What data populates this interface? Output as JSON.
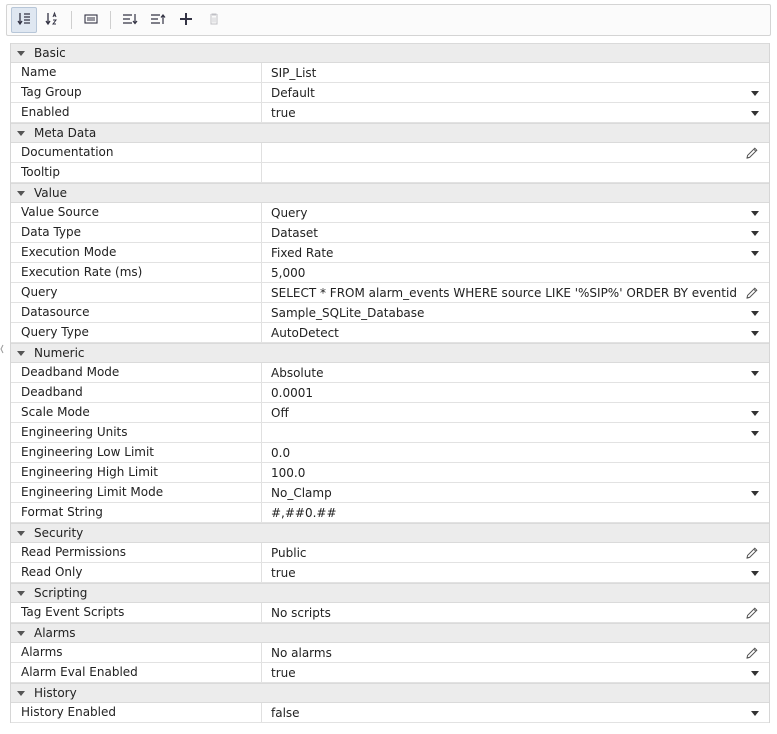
{
  "toolbar": {
    "buttons": [
      {
        "name": "sort-category-button",
        "icon": "sort-category-icon",
        "active": true
      },
      {
        "name": "sort-alpha-button",
        "icon": "sort-alpha-icon",
        "active": false
      },
      {
        "name": "toggle-description-button",
        "icon": "description-icon",
        "active": false
      },
      {
        "name": "expand-all-button",
        "icon": "expand-all-icon",
        "active": false
      },
      {
        "name": "collapse-all-button",
        "icon": "collapse-all-icon",
        "active": false
      },
      {
        "name": "add-property-button",
        "icon": "plus-icon",
        "active": false
      },
      {
        "name": "delete-property-button",
        "icon": "trash-icon",
        "active": false,
        "disabled": true
      }
    ]
  },
  "sections": [
    {
      "title": "Basic",
      "rows": [
        {
          "name": "Name",
          "value": "SIP_List",
          "control": "text"
        },
        {
          "name": "Tag Group",
          "value": "Default",
          "control": "dropdown"
        },
        {
          "name": "Enabled",
          "value": "true",
          "control": "dropdown"
        }
      ]
    },
    {
      "title": "Meta Data",
      "rows": [
        {
          "name": "Documentation",
          "value": "",
          "control": "edit"
        },
        {
          "name": "Tooltip",
          "value": "",
          "control": "text"
        }
      ]
    },
    {
      "title": "Value",
      "rows": [
        {
          "name": "Value Source",
          "value": "Query",
          "control": "dropdown"
        },
        {
          "name": "Data Type",
          "value": "Dataset",
          "control": "dropdown"
        },
        {
          "name": "Execution Mode",
          "value": "Fixed Rate",
          "control": "dropdown"
        },
        {
          "name": "Execution Rate (ms)",
          "value": "5,000",
          "control": "text"
        },
        {
          "name": "Query",
          "value": "SELECT * FROM alarm_events WHERE source LIKE '%SIP%' ORDER BY eventid",
          "control": "edit"
        },
        {
          "name": "Datasource",
          "value": "Sample_SQLite_Database",
          "control": "dropdown"
        },
        {
          "name": "Query Type",
          "value": "AutoDetect",
          "control": "dropdown"
        }
      ]
    },
    {
      "title": "Numeric",
      "rows": [
        {
          "name": "Deadband Mode",
          "value": "Absolute",
          "control": "dropdown"
        },
        {
          "name": "Deadband",
          "value": "0.0001",
          "control": "text"
        },
        {
          "name": "Scale Mode",
          "value": "Off",
          "control": "dropdown"
        },
        {
          "name": "Engineering Units",
          "value": "",
          "control": "dropdown"
        },
        {
          "name": "Engineering Low Limit",
          "value": "0.0",
          "control": "text"
        },
        {
          "name": "Engineering High Limit",
          "value": "100.0",
          "control": "text"
        },
        {
          "name": "Engineering Limit Mode",
          "value": "No_Clamp",
          "control": "dropdown"
        },
        {
          "name": "Format String",
          "value": "#,##0.##",
          "control": "text"
        }
      ]
    },
    {
      "title": "Security",
      "rows": [
        {
          "name": "Read Permissions",
          "value": "Public",
          "control": "edit"
        },
        {
          "name": "Read Only",
          "value": "true",
          "control": "dropdown"
        }
      ]
    },
    {
      "title": "Scripting",
      "rows": [
        {
          "name": "Tag Event Scripts",
          "value": "No scripts",
          "control": "edit"
        }
      ]
    },
    {
      "title": "Alarms",
      "rows": [
        {
          "name": "Alarms",
          "value": "No alarms",
          "control": "edit"
        },
        {
          "name": "Alarm Eval Enabled",
          "value": "true",
          "control": "dropdown"
        }
      ]
    },
    {
      "title": "History",
      "rows": [
        {
          "name": "History Enabled",
          "value": "false",
          "control": "dropdown"
        }
      ]
    }
  ]
}
